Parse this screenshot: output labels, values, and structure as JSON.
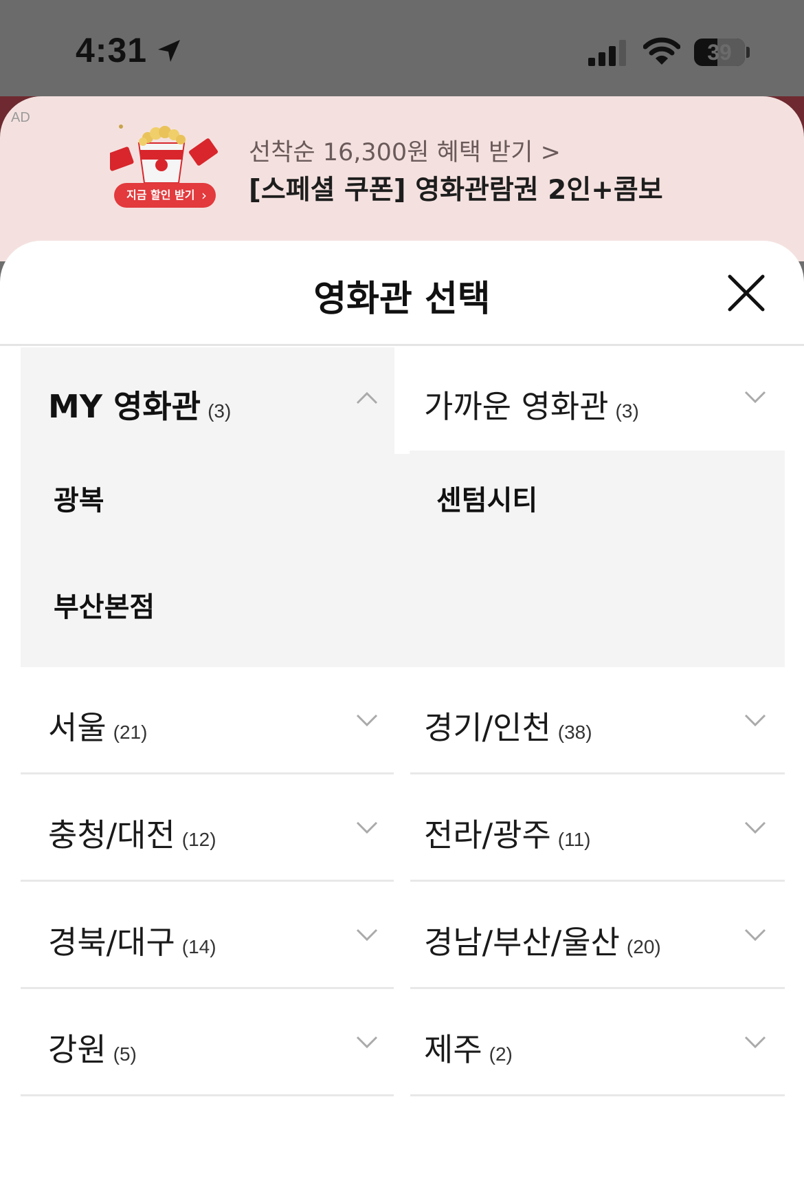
{
  "status_bar": {
    "time": "4:31",
    "battery": "39",
    "icons": [
      "location-arrow-icon",
      "signal-icon",
      "wifi-icon",
      "battery-icon"
    ]
  },
  "ad": {
    "tag": "AD",
    "cta": "지금 할인 받기",
    "line1": "선착순 16,300원 혜택 받기 >",
    "line2": "[스페셜 쿠폰] 영화관람권 2인+콤보"
  },
  "sheet": {
    "title": "영화관 선택"
  },
  "tabs": {
    "my": {
      "label": "MY 영화관",
      "count": "(3)",
      "expanded": true
    },
    "near": {
      "label": "가까운 영화관",
      "count": "(3)",
      "expanded": false
    }
  },
  "my_theaters": [
    "광복",
    "부산본점",
    "센텀시티"
  ],
  "regions": [
    {
      "label": "서울",
      "count": "(21)"
    },
    {
      "label": "경기/인천",
      "count": "(38)"
    },
    {
      "label": "충청/대전",
      "count": "(12)"
    },
    {
      "label": "전라/광주",
      "count": "(11)"
    },
    {
      "label": "경북/대구",
      "count": "(14)"
    },
    {
      "label": "경남/부산/울산",
      "count": "(20)"
    },
    {
      "label": "강원",
      "count": "(5)"
    },
    {
      "label": "제주",
      "count": "(2)"
    }
  ],
  "colors": {
    "ad_background": "#f4e1df",
    "ad_cta": "#e23a3d",
    "panel_gray": "#f4f4f4"
  }
}
